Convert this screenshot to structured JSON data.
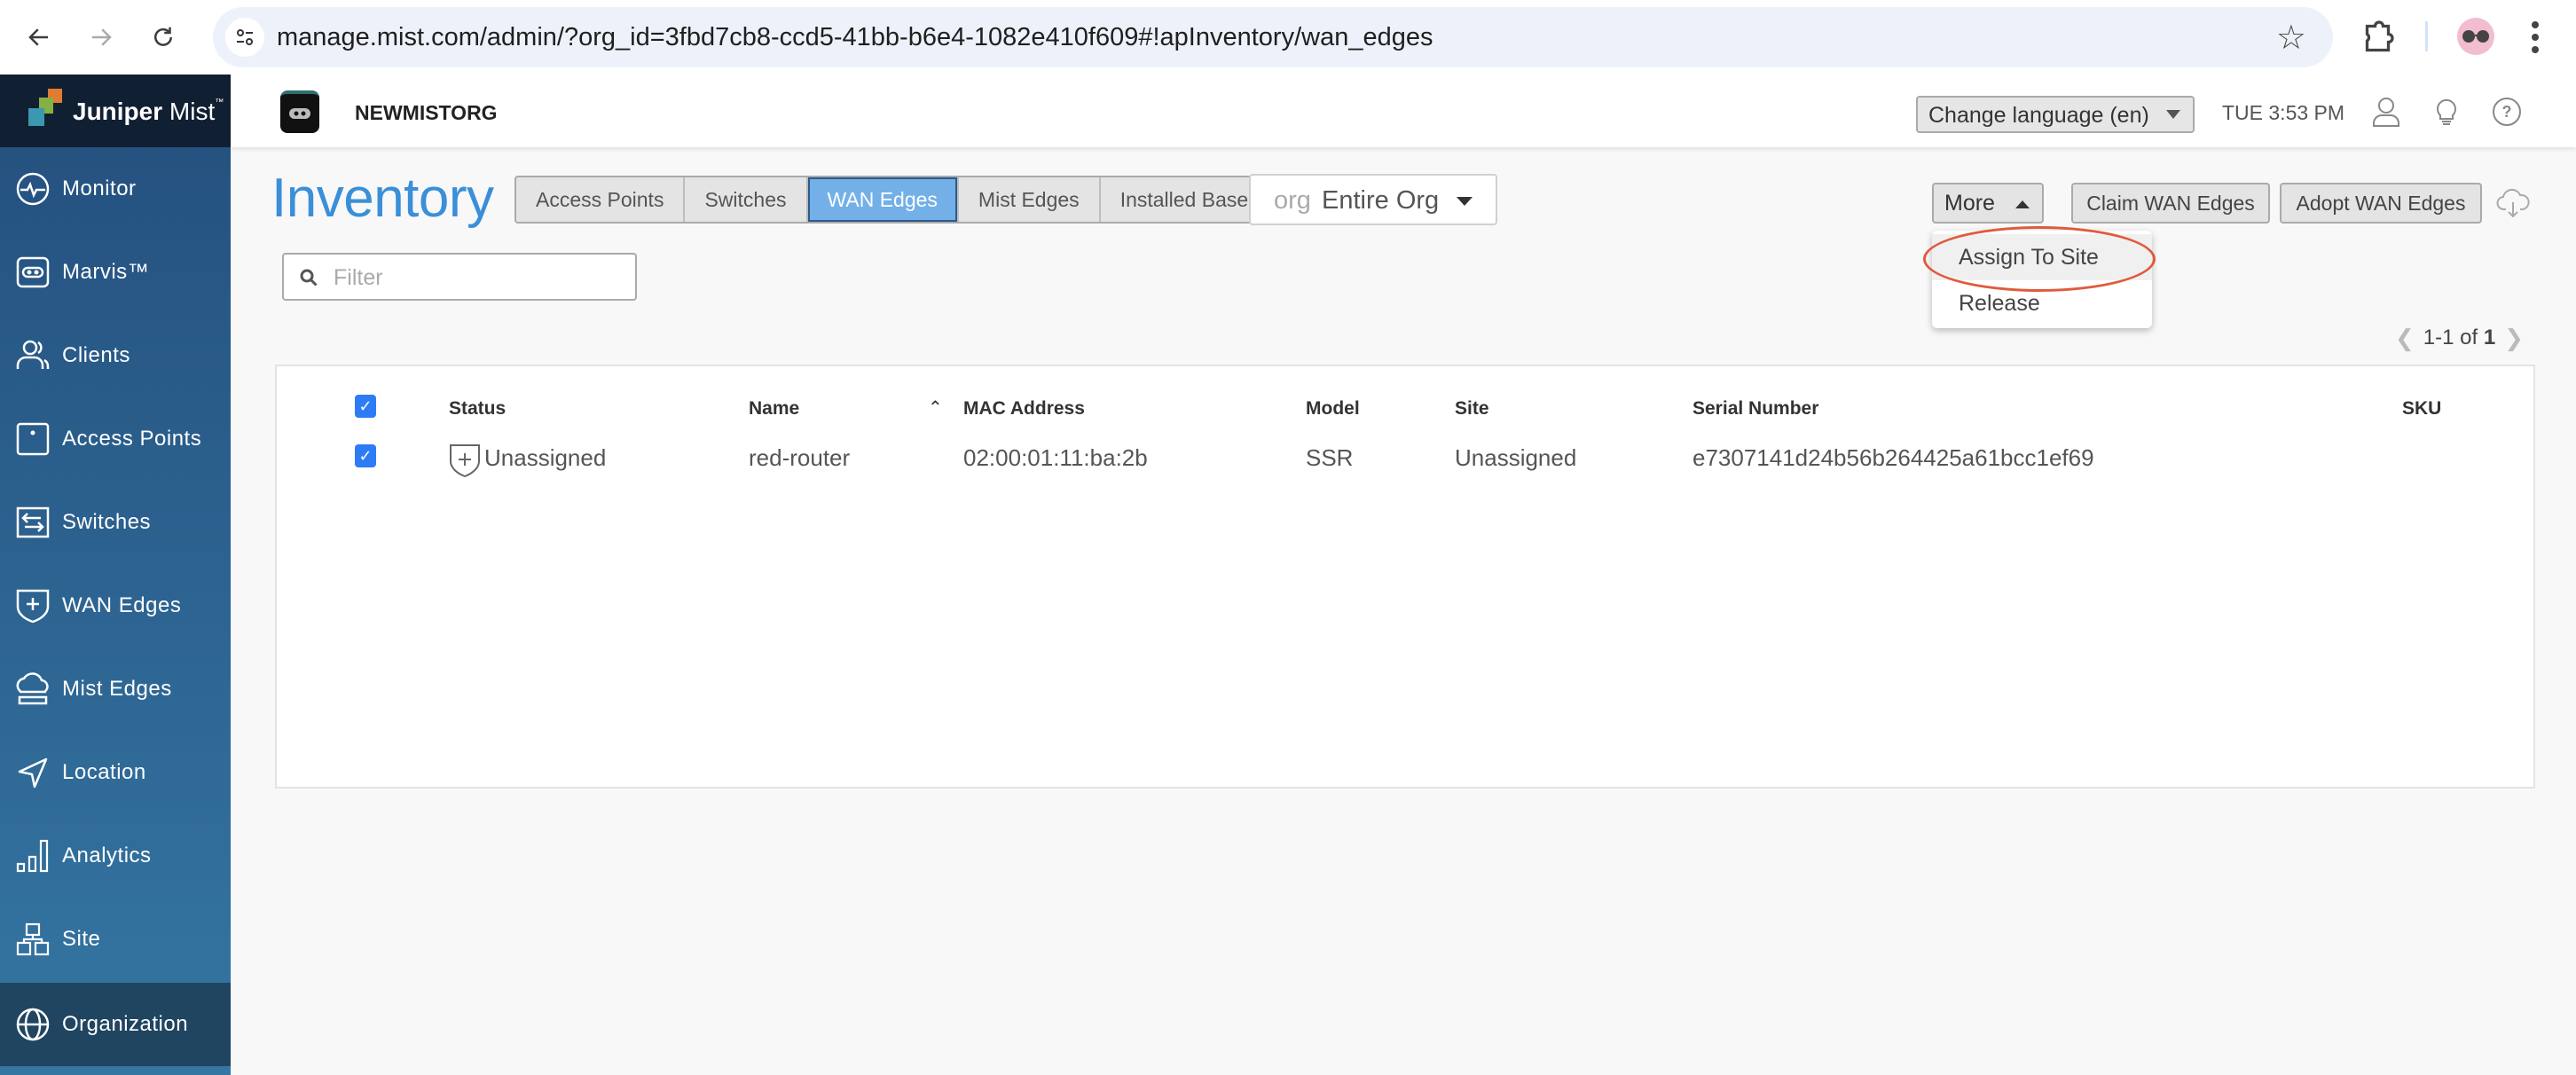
{
  "browser": {
    "url": "manage.mist.com/admin/?org_id=3fbd7cb8-ccd5-41bb-b6e4-1082e410f609#!apInventory/wan_edges"
  },
  "brand": {
    "name_bold": "Juniper",
    "name_light": "Mist",
    "tm": "™"
  },
  "sidebar": {
    "items": [
      {
        "label": "Monitor",
        "icon": "monitor-pulse-icon",
        "active": false
      },
      {
        "label": "Marvis™",
        "icon": "marvis-robot-icon",
        "active": false
      },
      {
        "label": "Clients",
        "icon": "clients-users-icon",
        "active": false
      },
      {
        "label": "Access Points",
        "icon": "access-point-icon",
        "active": false
      },
      {
        "label": "Switches",
        "icon": "switch-arrows-icon",
        "active": false
      },
      {
        "label": "WAN Edges",
        "icon": "wan-shield-icon",
        "active": false
      },
      {
        "label": "Mist Edges",
        "icon": "mist-edge-cloud-icon",
        "active": false
      },
      {
        "label": "Location",
        "icon": "location-arrow-icon",
        "active": false
      },
      {
        "label": "Analytics",
        "icon": "analytics-bars-icon",
        "active": false
      },
      {
        "label": "Site",
        "icon": "site-boxes-icon",
        "active": false
      },
      {
        "label": "Organization",
        "icon": "globe-icon",
        "active": true
      }
    ]
  },
  "topbar": {
    "org_name": "NEWMISTORG",
    "language": "Change language (en)",
    "clock": "TUE 3:53 PM"
  },
  "page": {
    "title": "Inventory",
    "tabs": [
      {
        "label": "Access Points",
        "active": false
      },
      {
        "label": "Switches",
        "active": false
      },
      {
        "label": "WAN Edges",
        "active": true
      },
      {
        "label": "Mist Edges",
        "active": false
      },
      {
        "label": "Installed Base",
        "active": false
      }
    ],
    "scope_prefix": "org",
    "scope_value": "Entire Org",
    "filter_placeholder": "Filter",
    "filter_value": "",
    "more_label": "More",
    "claim_label": "Claim WAN Edges",
    "adopt_label": "Adopt WAN Edges",
    "more_menu": [
      {
        "label": "Assign To Site",
        "highlighted": true
      },
      {
        "label": "Release",
        "highlighted": false
      }
    ],
    "pagination": {
      "range": "1-1 of",
      "total": "1"
    }
  },
  "table": {
    "select_all_checked": true,
    "columns": [
      "Status",
      "Name",
      "MAC Address",
      "Model",
      "Site",
      "Serial Number",
      "SKU"
    ],
    "sorted_column": "MAC Address",
    "rows": [
      {
        "checked": true,
        "status": "Unassigned",
        "name": "red-router",
        "mac": "02:00:01:11:ba:2b",
        "model": "SSR",
        "site": "Unassigned",
        "serial": "e7307141d24b56b264425a61bcc1ef69",
        "sku": ""
      }
    ]
  },
  "colors": {
    "accent": "#3a8fd8",
    "active_tab": "#73b0e8",
    "sidebar_top": "#244f7d",
    "sidebar_bottom": "#3576a3",
    "sidebar_active": "#1f4560",
    "checkbox": "#2d7cf6",
    "annotation": "#e05a3c"
  }
}
